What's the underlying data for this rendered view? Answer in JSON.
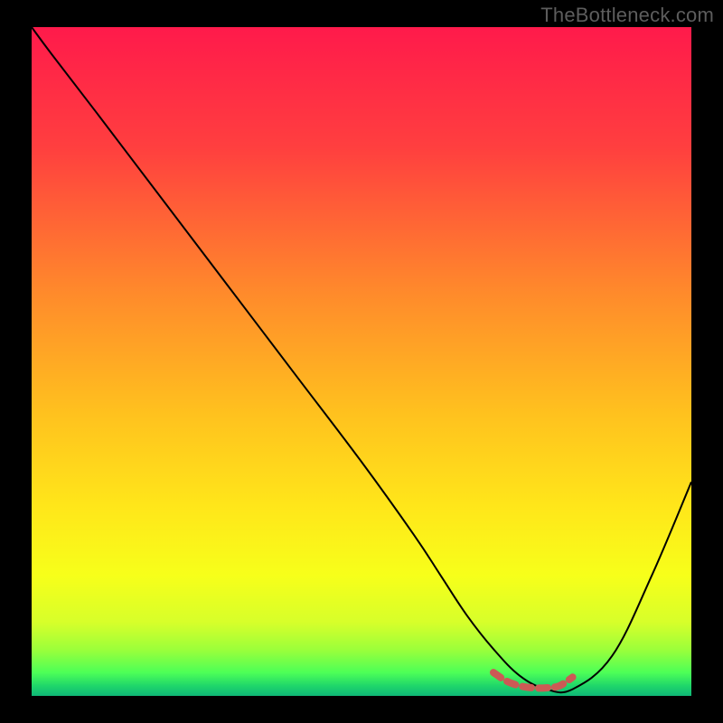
{
  "watermark": "TheBottleneck.com",
  "chart_data": {
    "type": "line",
    "title": "",
    "xlabel": "",
    "ylabel": "",
    "xlim": [
      0,
      100
    ],
    "ylim": [
      0,
      100
    ],
    "series": [
      {
        "name": "bottleneck-curve",
        "x": [
          0,
          3,
          10,
          20,
          30,
          40,
          50,
          58,
          62,
          66,
          70,
          74,
          78,
          82,
          88,
          94,
          100
        ],
        "y": [
          100,
          96,
          87,
          74,
          61,
          48,
          35,
          24,
          18,
          12,
          7,
          3,
          1,
          1,
          6,
          18,
          32
        ]
      },
      {
        "name": "optimal-range-marker",
        "x": [
          70,
          72,
          74,
          76,
          78,
          80,
          82
        ],
        "y": [
          3.5,
          2.2,
          1.5,
          1.2,
          1.2,
          1.5,
          2.8
        ]
      }
    ],
    "gradient_stops": [
      {
        "offset": 0,
        "color": "#ff1a4b"
      },
      {
        "offset": 0.18,
        "color": "#ff3f3f"
      },
      {
        "offset": 0.4,
        "color": "#ff8b2b"
      },
      {
        "offset": 0.58,
        "color": "#ffc21e"
      },
      {
        "offset": 0.72,
        "color": "#ffe71a"
      },
      {
        "offset": 0.82,
        "color": "#f7ff1a"
      },
      {
        "offset": 0.89,
        "color": "#d7ff2a"
      },
      {
        "offset": 0.93,
        "color": "#9dff3a"
      },
      {
        "offset": 0.965,
        "color": "#4dff57"
      },
      {
        "offset": 0.985,
        "color": "#1fd66a"
      },
      {
        "offset": 1.0,
        "color": "#0fb877"
      }
    ],
    "colors": {
      "curve": "#000000",
      "marker": "#cc5a55",
      "background_frame": "#000000"
    }
  }
}
